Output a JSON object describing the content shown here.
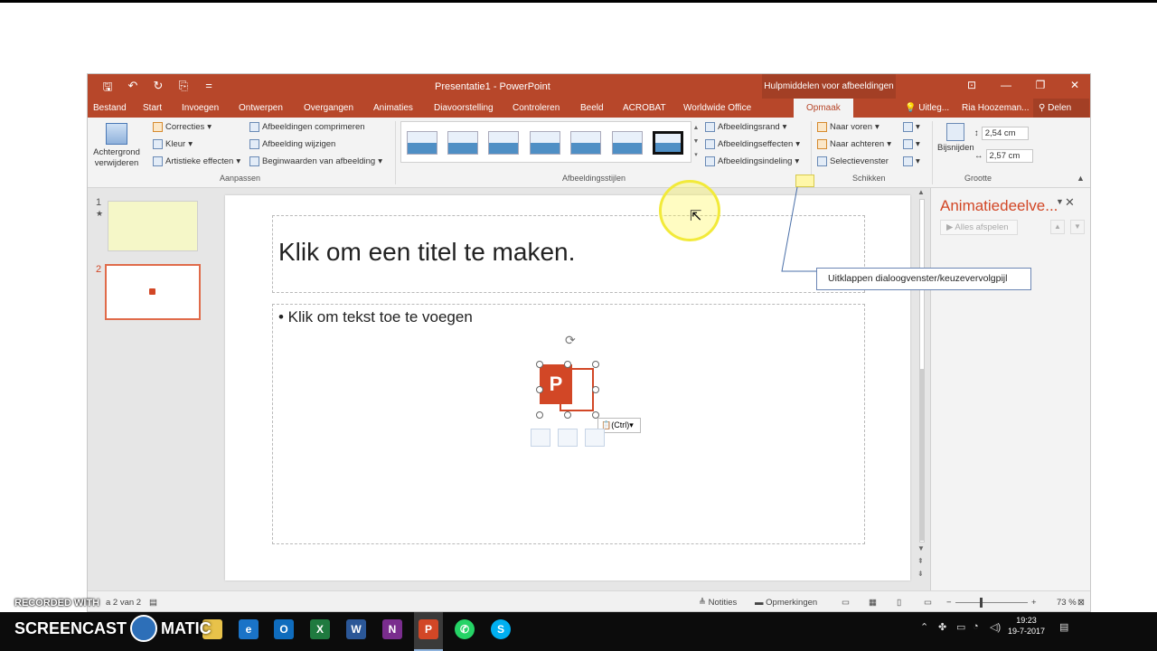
{
  "window": {
    "title": "Presentatie1 - PowerPoint",
    "context_label": "Hulpmiddelen voor afbeeldingen",
    "controls": [
      "⊡",
      "—",
      "❐",
      "✕"
    ]
  },
  "qat": [
    "🖫",
    "↶",
    "↻",
    "⎘",
    "="
  ],
  "tabs": [
    {
      "label": "Bestand"
    },
    {
      "label": "Start"
    },
    {
      "label": "Invoegen"
    },
    {
      "label": "Ontwerpen"
    },
    {
      "label": "Overgangen"
    },
    {
      "label": "Animaties"
    },
    {
      "label": "Diavoorstelling"
    },
    {
      "label": "Controleren"
    },
    {
      "label": "Beeld"
    },
    {
      "label": "ACROBAT"
    },
    {
      "label": "Worldwide Office"
    },
    {
      "label": "Opmaak"
    }
  ],
  "tellme": "Uitleg...",
  "user": "Ria Hoozeman...",
  "share": "Delen",
  "ribbon": {
    "remove_bg": [
      "Achtergrond",
      "verwijderen"
    ],
    "adjust": {
      "corrections": "Correcties",
      "color": "Kleur",
      "artistic": "Artistieke effecten",
      "compress": "Afbeeldingen comprimeren",
      "change": "Afbeelding wijzigen",
      "reset": "Beginwaarden van afbeelding",
      "label": "Aanpassen"
    },
    "styles": {
      "border": "Afbeeldingsrand",
      "effects": "Afbeeldingseffecten",
      "layout": "Afbeeldingsindeling",
      "label": "Afbeeldingsstijlen"
    },
    "arrange": {
      "forward": "Naar voren",
      "backward": "Naar achteren",
      "selection": "Selectievenster",
      "label": "Schikken"
    },
    "size": {
      "crop": "Bijsnijden",
      "height": "2,54 cm",
      "width": "2,57 cm",
      "label": "Grootte"
    }
  },
  "slides": {
    "numbers": [
      "1",
      "2"
    ],
    "star": "★"
  },
  "slide": {
    "title_placeholder": "Klik om een titel te maken.",
    "body_placeholder": "• Klik om tekst toe te voegen",
    "paste_tag": "(Ctrl)",
    "logo_letter": "P"
  },
  "anim_pane": {
    "title": "Animatiedeelve...",
    "play_all": "Alles afspelen"
  },
  "status": {
    "slide_of": "a 2 van 2",
    "notes": "Notities",
    "comments": "Opmerkingen",
    "zoom": "73 %"
  },
  "tooltip": "Uitklappen dialoogvenster/keuzevervolgpijl",
  "taskbar": {
    "time": "19:23",
    "date": "19-7-2017"
  },
  "watermark": {
    "line1": "RECORDED WITH",
    "line2a": "SCREENCAST",
    "line2b": "MATIC"
  },
  "colors": {
    "accent": "#b7472a",
    "ppt_red": "#d24726"
  }
}
